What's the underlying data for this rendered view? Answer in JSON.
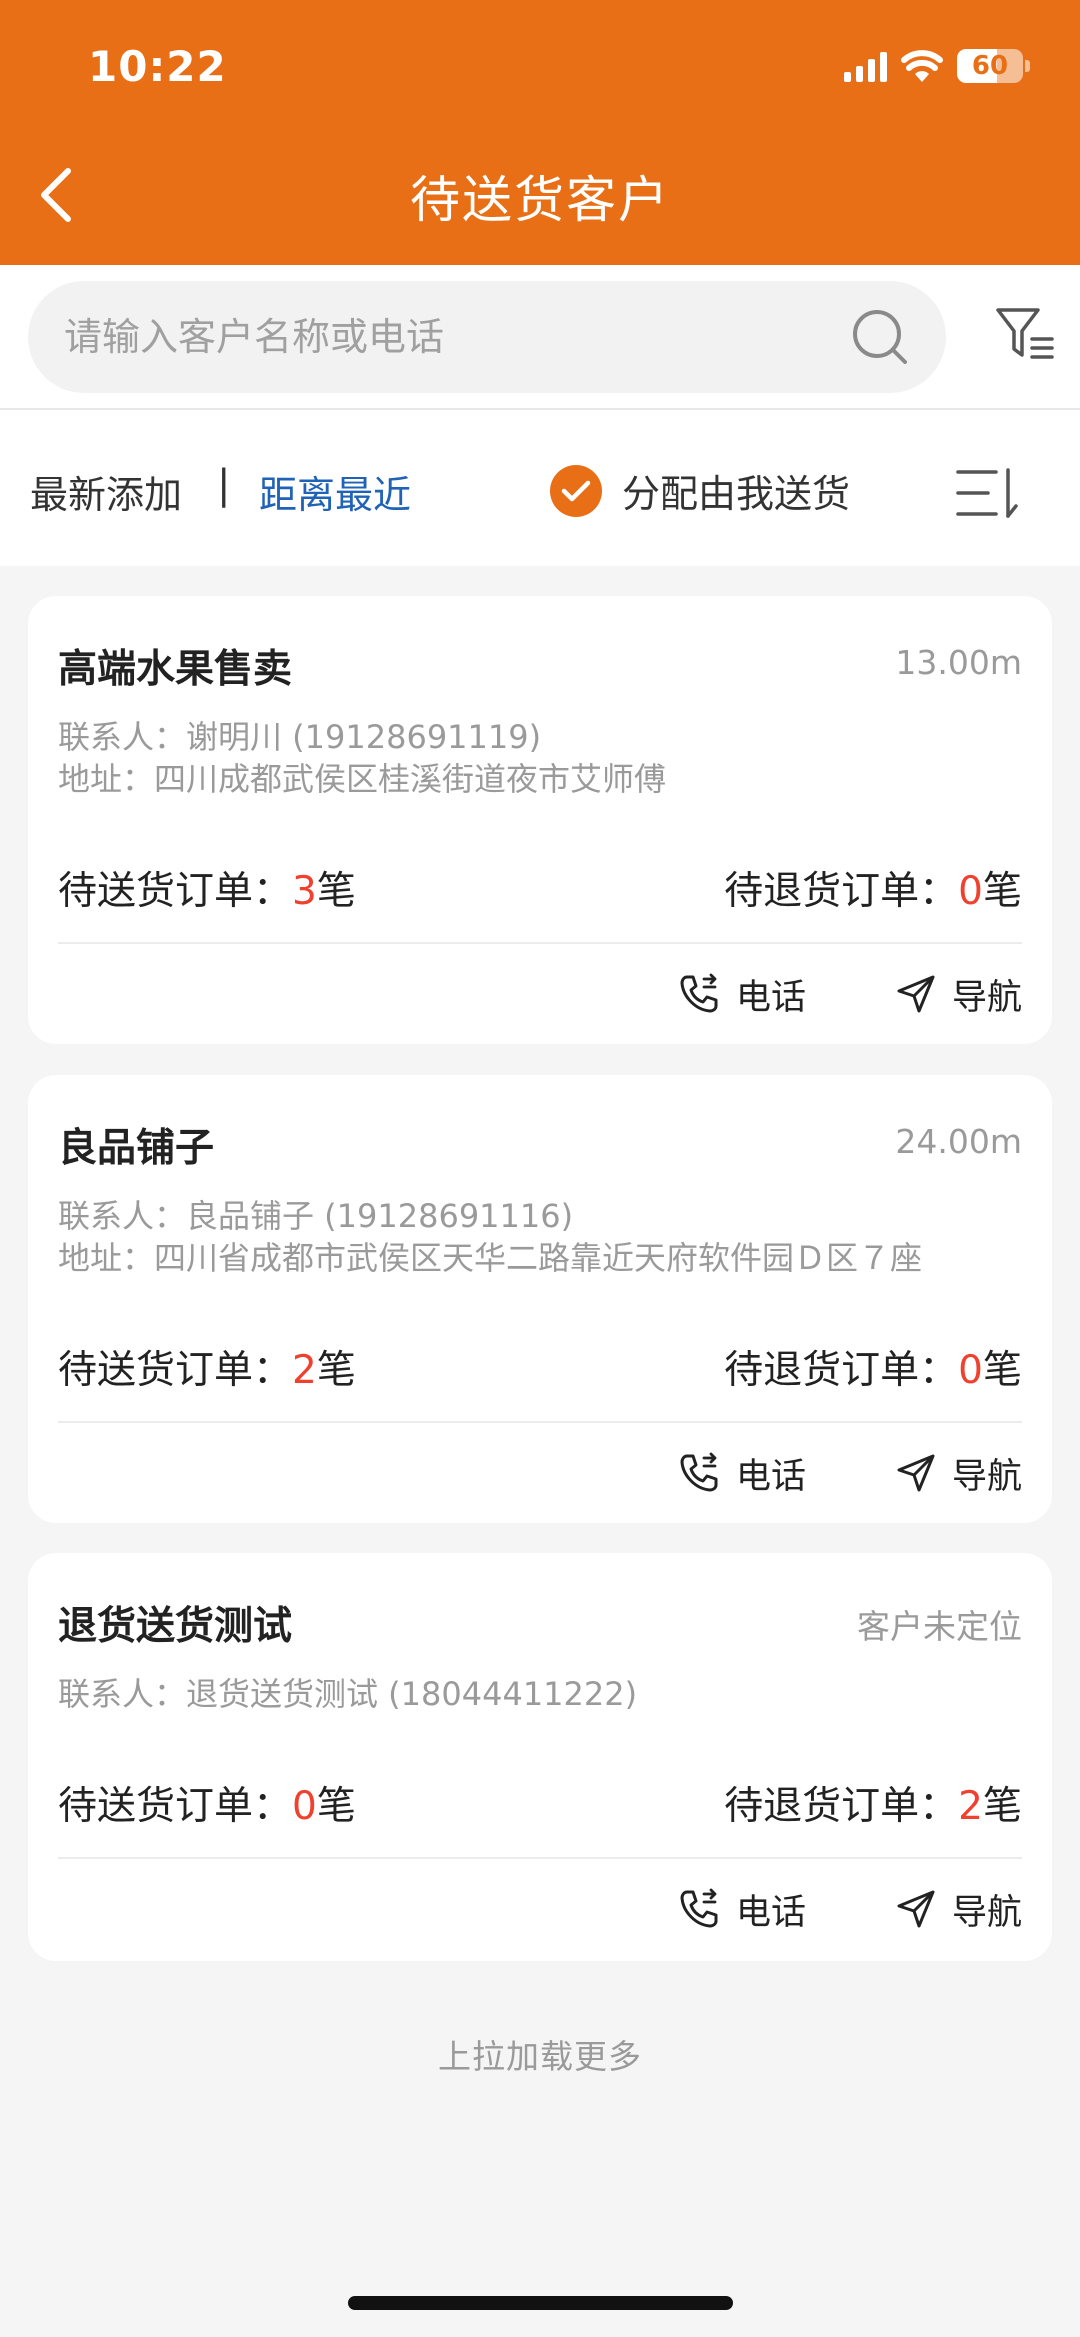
{
  "status_bar": {
    "time": "10:22",
    "battery": "60",
    "battery_level": 0.6
  },
  "header": {
    "title": "待送货客户"
  },
  "search": {
    "placeholder": "请输入客户名称或电话"
  },
  "sort": {
    "latest": "最新添加",
    "separator": "|",
    "nearest": "距离最近",
    "assign_label": "分配由我送货",
    "assign_checked": true
  },
  "colors": {
    "accent": "#e86f16",
    "link": "#1f62b6",
    "count": "#f0412f"
  },
  "labels": {
    "pending_delivery": "待送货订单：",
    "pending_return": "待退货订单：",
    "unit": "笔",
    "call": "电话",
    "navigate": "导航"
  },
  "customers": [
    {
      "name": "高端水果售卖",
      "distance": "13.00m",
      "contact": "联系人：谢明川 (19128691119)",
      "address": "地址：四川成都武侯区桂溪街道夜市艾师傅",
      "delivery_count": "3",
      "return_count": "0"
    },
    {
      "name": "良品铺子",
      "distance": "24.00m",
      "contact": "联系人：良品铺子 (19128691116)",
      "address": "地址：四川省成都市武侯区天华二路靠近天府软件园Ｄ区７座",
      "delivery_count": "2",
      "return_count": "0"
    },
    {
      "name": "退货送货测试",
      "distance": "客户未定位",
      "contact": "联系人：退货送货测试 (18044411222)",
      "delivery_count": "0",
      "return_count": "2"
    }
  ],
  "footer": {
    "load_more": "上拉加载更多"
  }
}
